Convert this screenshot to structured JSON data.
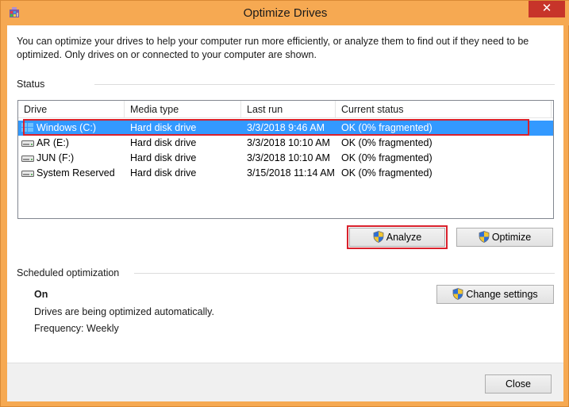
{
  "window": {
    "title": "Optimize Drives",
    "close_glyph": "✕"
  },
  "intro": "You can optimize your drives to help your computer run more efficiently, or analyze them to find out if they need to be optimized. Only drives on or connected to your computer are shown.",
  "status": {
    "label": "Status",
    "columns": [
      "Drive",
      "Media type",
      "Last run",
      "Current status"
    ],
    "rows": [
      {
        "drive": "Windows (C:)",
        "icon": "windows-drive-icon",
        "media": "Hard disk drive",
        "last_run": "3/3/2018 9:46 AM",
        "status": "OK (0% fragmented)"
      },
      {
        "drive": "AR (E:)",
        "icon": "hard-drive-icon",
        "media": "Hard disk drive",
        "last_run": "3/3/2018 10:10 AM",
        "status": "OK (0% fragmented)"
      },
      {
        "drive": "JUN (F:)",
        "icon": "hard-drive-icon",
        "media": "Hard disk drive",
        "last_run": "3/3/2018 10:10 AM",
        "status": "OK (0% fragmented)"
      },
      {
        "drive": "System Reserved",
        "icon": "hard-drive-icon",
        "media": "Hard disk drive",
        "last_run": "3/15/2018 11:14 AM",
        "status": "OK (0% fragmented)"
      }
    ]
  },
  "buttons": {
    "analyze": "Analyze",
    "optimize": "Optimize",
    "change_settings": "Change settings",
    "close": "Close"
  },
  "scheduled": {
    "label": "Scheduled optimization",
    "state": "On",
    "description": "Drives are being optimized automatically.",
    "frequency": "Frequency: Weekly"
  },
  "colors": {
    "title_bar": "#f6a952",
    "close_button": "#c7342a",
    "selection": "#3399ff",
    "highlight_outline": "#d9212c"
  }
}
